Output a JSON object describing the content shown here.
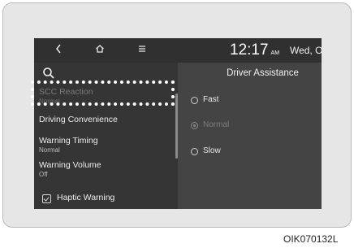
{
  "topbar": {
    "back_icon": "chevron-left-icon",
    "home_icon": "home-icon",
    "menu_icon": "menu-icon",
    "time": "12:17",
    "ampm": "AM",
    "date": "Wed, Oc"
  },
  "left_menu": {
    "search_icon": "search-icon",
    "items": [
      {
        "label": "SCC Reaction",
        "value": "Normal"
      },
      {
        "label": "Driving Convenience"
      },
      {
        "label": "Warning Timing",
        "value": "Normal"
      },
      {
        "label": "Warning Volume",
        "value": "Off"
      },
      {
        "label": "Haptic Warning",
        "checked": false
      }
    ]
  },
  "right_panel": {
    "title": "Driver Assistance",
    "options": [
      {
        "label": "Fast",
        "selected": false,
        "enabled": true
      },
      {
        "label": "Normal",
        "selected": true,
        "enabled": false
      },
      {
        "label": "Slow",
        "selected": false,
        "enabled": true
      }
    ]
  },
  "caption": "OIK070132L"
}
